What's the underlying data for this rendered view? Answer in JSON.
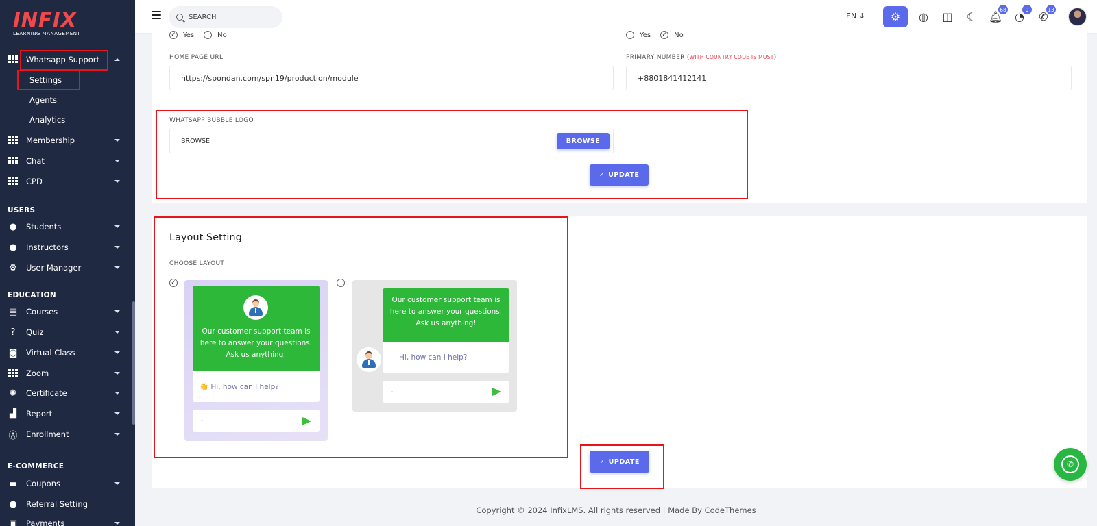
{
  "brand": {
    "name": "INFIX",
    "subtitle": "LEARNING MANAGEMENT",
    "accent": "#5a6aeb",
    "sidebar_bg": "#202942"
  },
  "sidebar": {
    "whatsapp": {
      "label": "Whatsapp Support",
      "icon": "grid-icon"
    },
    "whatsapp_sub": [
      "Settings",
      "Agents",
      "Analytics"
    ],
    "menu1": [
      {
        "label": "Membership",
        "icon": "grid-icon"
      },
      {
        "label": "Chat",
        "icon": "grid-icon"
      },
      {
        "label": "CPD",
        "icon": "grid-icon"
      }
    ],
    "users_title": "USERS",
    "users": [
      {
        "label": "Students",
        "icon": "user-icon"
      },
      {
        "label": "Instructors",
        "icon": "instructor-icon"
      },
      {
        "label": "User Manager",
        "icon": "user-manager-icon"
      }
    ],
    "education_title": "EDUCATION",
    "education": [
      {
        "label": "Courses",
        "icon": "book-icon"
      },
      {
        "label": "Quiz",
        "icon": "question-icon"
      },
      {
        "label": "Virtual Class",
        "icon": "vr-icon"
      },
      {
        "label": "Zoom",
        "icon": "grid-icon"
      },
      {
        "label": "Certificate",
        "icon": "certificate-icon"
      },
      {
        "label": "Report",
        "icon": "chart-icon"
      },
      {
        "label": "Enrollment",
        "icon": "enrollment-icon"
      }
    ],
    "ecommerce_title": "E-COMMERCE",
    "ecommerce": [
      {
        "label": "Coupons",
        "icon": "coupon-icon"
      },
      {
        "label": "Referral Setting",
        "icon": "referral-icon"
      },
      {
        "label": "Payments",
        "icon": "payment-icon"
      }
    ]
  },
  "header": {
    "search_placeholder": "SEARCH",
    "lang": "EN",
    "badges": {
      "notifications": "68",
      "messages": "0",
      "whatsapp": "13"
    }
  },
  "form": {
    "radio_left": {
      "yes": "Yes",
      "no": "No"
    },
    "radio_right": {
      "yes": "Yes",
      "no": "No"
    },
    "home_url_label": "HOME PAGE URL",
    "home_url_value": "https://spondan.com/spn19/production/module",
    "primary_number_label": "PRIMARY NUMBER (",
    "primary_number_note": "WITH COUNTRY CODE IS MUST",
    "primary_number_close": ")",
    "primary_number_value": "+8801841412141",
    "logo_label": "WHATSAPP BUBBLE LOGO",
    "logo_value": "BROWSE",
    "browse_btn": "BROWSE",
    "update_btn": "UPDATE"
  },
  "layout": {
    "title": "Layout Setting",
    "choose_label": "CHOOSE LAYOUT",
    "preview_message": "Our customer support team is here to answer your questions. Ask us anything!",
    "greeting1": "👋 Hi, how can I help?",
    "greeting2": "Hi, how can I help?",
    "input_hint": "-",
    "update_btn": "UPDATE",
    "selected": 1
  },
  "footer": {
    "text": "Copyright © 2024 InfixLMS. All rights reserved | Made By CodeThemes"
  }
}
